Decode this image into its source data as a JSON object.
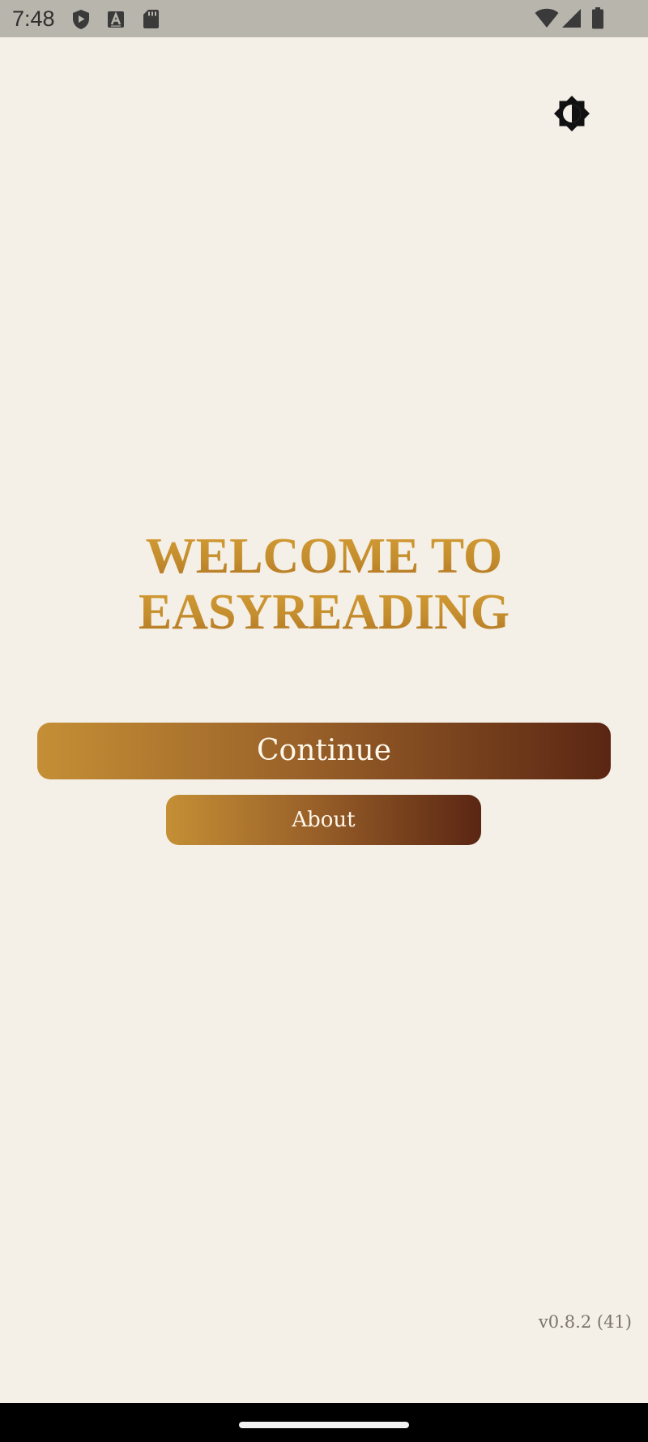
{
  "status_bar": {
    "time": "7:48",
    "icons": [
      "shield-icon",
      "text-a-icon",
      "sd-card-icon",
      "wifi-icon",
      "signal-icon",
      "battery-icon"
    ]
  },
  "header": {
    "theme_toggle_icon": "brightness-contrast-icon"
  },
  "welcome": {
    "line1": "WELCOME TO",
    "line2": "EASYREADING"
  },
  "buttons": {
    "continue": "Continue",
    "about": "About"
  },
  "footer": {
    "version": "v0.8.2 (41)"
  },
  "colors": {
    "background": "#f5f0e7",
    "status_bar": "#b8b5ad",
    "title_gold": "#c38d30",
    "button_gradient_start": "#c48f35",
    "button_gradient_end": "#5a2613",
    "button_text": "#fff8ec",
    "version_text": "#7b746b"
  }
}
